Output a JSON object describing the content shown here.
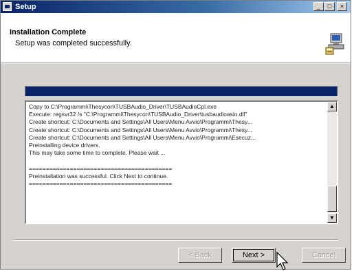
{
  "window": {
    "title": "Setup",
    "controls": {
      "minimize": "_",
      "maximize": "□",
      "close": "×"
    }
  },
  "header": {
    "title": "Installation Complete",
    "subtitle": "Setup was completed successfully.",
    "icon": "setup-computer-icon"
  },
  "progress": {
    "value": 1.0
  },
  "log": {
    "lines": [
      "Copy to C:\\Programmi\\Thesycon\\TUSBAudio_Driver\\TUSBAudioCpl.exe",
      "Execute: regsvr32 /s \"C:\\Programmi\\Thesycon\\TUSBAudio_Driver\\tusbaudioasio.dll\"",
      "Create shortcut: C:\\Documents and Settings\\All Users\\Menu Avvio\\Programmi\\Thesy...",
      "Create shortcut: C:\\Documents and Settings\\All Users\\Menu Avvio\\Programmi\\Thesy...",
      "Create shortcut: C:\\Documents and Settings\\All Users\\Menu Avvio\\Programmi\\Esecuz...",
      "Preinstalling device drivers.",
      "This may take some time to complete. Please wait ...",
      "",
      "==========================================",
      "Preinstallation was successful. Click Next to continue.",
      "=========================================="
    ],
    "scroll_up": "▲",
    "scroll_down": "▼"
  },
  "buttons": {
    "back": "< Back",
    "next": "Next >",
    "cancel": "Cancel"
  },
  "colors": {
    "title_bar": "#0a246a",
    "progress_fill": "#0a246a",
    "dialog_face": "#d6d3ce"
  }
}
